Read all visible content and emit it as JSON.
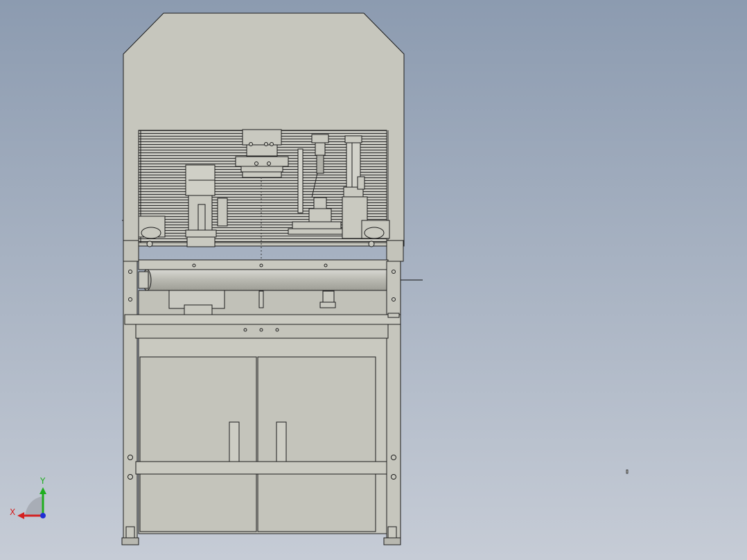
{
  "viewport": {
    "background_top": "#8c9bb0",
    "background_bottom": "#c6ccd6",
    "model_color": "#c9c9c0",
    "line_color": "#1c1c1c"
  },
  "triad": {
    "x_label": "X",
    "y_label": "Y",
    "x_color": "#d42020",
    "y_color": "#1fae1f",
    "z_color": "#1f2fd4"
  }
}
